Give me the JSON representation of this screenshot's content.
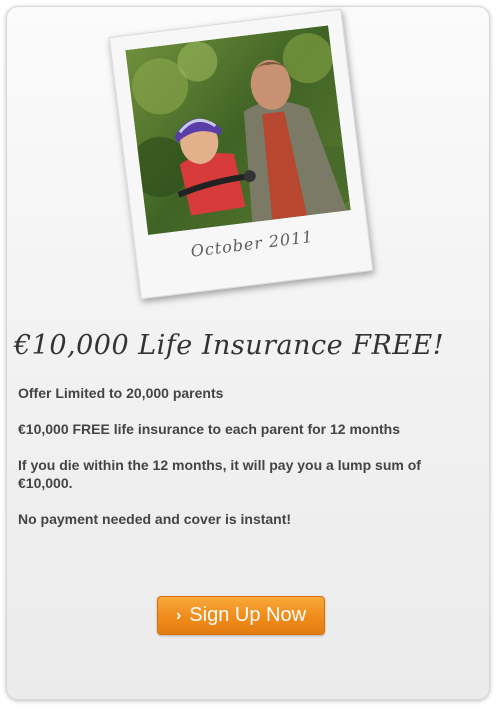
{
  "photo_card": {
    "caption": "October 2011",
    "image_subject": "father-and-child-on-bicycle-photo"
  },
  "headline": "€10,000 Life Insurance FREE!",
  "lines": [
    "Offer Limited to 20,000 parents",
    "€10,000 FREE life insurance to each parent for 12 months",
    "If you die within the 12 months, it will pay you a lump sum of €10,000.",
    "No payment needed and cover is instant!"
  ],
  "cta": {
    "label": "Sign Up Now",
    "icon": "chevron-right-icon"
  },
  "colors": {
    "button": "#ef8b1b",
    "text": "#444444",
    "headline": "#333333"
  }
}
